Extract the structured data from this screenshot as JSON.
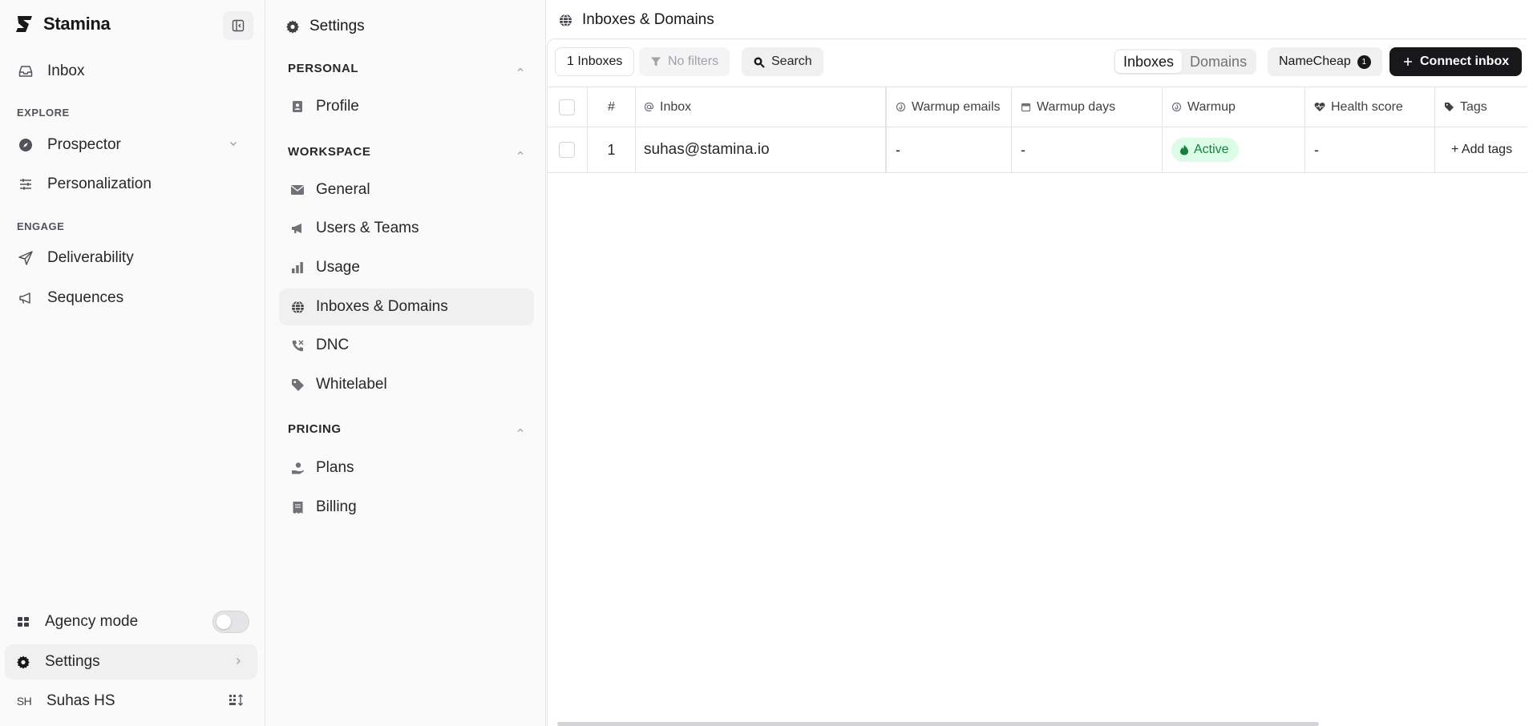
{
  "app": {
    "name": "Stamina"
  },
  "sidebar": {
    "items": [
      {
        "label": "Inbox"
      },
      {
        "label": "Prospector"
      },
      {
        "label": "Personalization"
      },
      {
        "label": "Deliverability"
      },
      {
        "label": "Sequences"
      }
    ],
    "sections": [
      "EXPLORE",
      "ENGAGE"
    ],
    "agency_mode": {
      "label": "Agency mode",
      "enabled": false
    },
    "settings_label": "Settings",
    "user": {
      "initials": "SH",
      "name": "Suhas HS"
    }
  },
  "settings_nav": {
    "title": "Settings",
    "sections": [
      {
        "label": "PERSONAL",
        "items": [
          {
            "label": "Profile"
          }
        ]
      },
      {
        "label": "WORKSPACE",
        "items": [
          {
            "label": "General"
          },
          {
            "label": "Users & Teams"
          },
          {
            "label": "Usage"
          },
          {
            "label": "Inboxes & Domains"
          },
          {
            "label": "DNC"
          },
          {
            "label": "Whitelabel"
          }
        ]
      },
      {
        "label": "PRICING",
        "items": [
          {
            "label": "Plans"
          },
          {
            "label": "Billing"
          }
        ]
      }
    ],
    "active": "Inboxes & Domains"
  },
  "main": {
    "title": "Inboxes & Domains",
    "toolbar": {
      "count_label": "1 Inboxes",
      "filter_label": "No filters",
      "search_label": "Search",
      "segments": [
        "Inboxes",
        "Domains"
      ],
      "active_segment": "Inboxes",
      "provider_label": "NameCheap",
      "provider_count": "1",
      "connect_label": "Connect inbox"
    },
    "table": {
      "columns": [
        "#",
        "Inbox",
        "Warmup emails",
        "Warmup days",
        "Warmup",
        "Health score",
        "Tags"
      ],
      "rows": [
        {
          "num": "1",
          "inbox": "suhas@stamina.io",
          "warmup_emails": "-",
          "warmup_days": "-",
          "warmup": "Active",
          "health_score": "-",
          "tags": "+ Add tags"
        }
      ]
    }
  },
  "colors": {
    "accent": "#18181b",
    "active_bg": "#dcfce7",
    "active_fg": "#15803d"
  }
}
